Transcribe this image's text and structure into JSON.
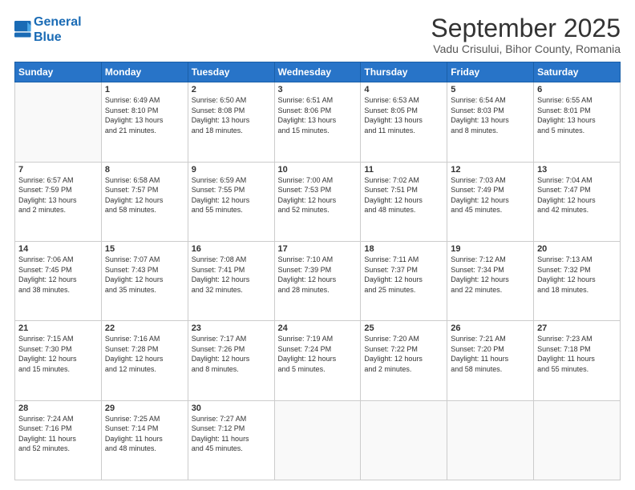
{
  "logo": {
    "line1": "General",
    "line2": "Blue"
  },
  "header": {
    "month": "September 2025",
    "location": "Vadu Crisului, Bihor County, Romania"
  },
  "days_of_week": [
    "Sunday",
    "Monday",
    "Tuesday",
    "Wednesday",
    "Thursday",
    "Friday",
    "Saturday"
  ],
  "weeks": [
    [
      {
        "day": "",
        "detail": ""
      },
      {
        "day": "1",
        "detail": "Sunrise: 6:49 AM\nSunset: 8:10 PM\nDaylight: 13 hours\nand 21 minutes."
      },
      {
        "day": "2",
        "detail": "Sunrise: 6:50 AM\nSunset: 8:08 PM\nDaylight: 13 hours\nand 18 minutes."
      },
      {
        "day": "3",
        "detail": "Sunrise: 6:51 AM\nSunset: 8:06 PM\nDaylight: 13 hours\nand 15 minutes."
      },
      {
        "day": "4",
        "detail": "Sunrise: 6:53 AM\nSunset: 8:05 PM\nDaylight: 13 hours\nand 11 minutes."
      },
      {
        "day": "5",
        "detail": "Sunrise: 6:54 AM\nSunset: 8:03 PM\nDaylight: 13 hours\nand 8 minutes."
      },
      {
        "day": "6",
        "detail": "Sunrise: 6:55 AM\nSunset: 8:01 PM\nDaylight: 13 hours\nand 5 minutes."
      }
    ],
    [
      {
        "day": "7",
        "detail": "Sunrise: 6:57 AM\nSunset: 7:59 PM\nDaylight: 13 hours\nand 2 minutes."
      },
      {
        "day": "8",
        "detail": "Sunrise: 6:58 AM\nSunset: 7:57 PM\nDaylight: 12 hours\nand 58 minutes."
      },
      {
        "day": "9",
        "detail": "Sunrise: 6:59 AM\nSunset: 7:55 PM\nDaylight: 12 hours\nand 55 minutes."
      },
      {
        "day": "10",
        "detail": "Sunrise: 7:00 AM\nSunset: 7:53 PM\nDaylight: 12 hours\nand 52 minutes."
      },
      {
        "day": "11",
        "detail": "Sunrise: 7:02 AM\nSunset: 7:51 PM\nDaylight: 12 hours\nand 48 minutes."
      },
      {
        "day": "12",
        "detail": "Sunrise: 7:03 AM\nSunset: 7:49 PM\nDaylight: 12 hours\nand 45 minutes."
      },
      {
        "day": "13",
        "detail": "Sunrise: 7:04 AM\nSunset: 7:47 PM\nDaylight: 12 hours\nand 42 minutes."
      }
    ],
    [
      {
        "day": "14",
        "detail": "Sunrise: 7:06 AM\nSunset: 7:45 PM\nDaylight: 12 hours\nand 38 minutes."
      },
      {
        "day": "15",
        "detail": "Sunrise: 7:07 AM\nSunset: 7:43 PM\nDaylight: 12 hours\nand 35 minutes."
      },
      {
        "day": "16",
        "detail": "Sunrise: 7:08 AM\nSunset: 7:41 PM\nDaylight: 12 hours\nand 32 minutes."
      },
      {
        "day": "17",
        "detail": "Sunrise: 7:10 AM\nSunset: 7:39 PM\nDaylight: 12 hours\nand 28 minutes."
      },
      {
        "day": "18",
        "detail": "Sunrise: 7:11 AM\nSunset: 7:37 PM\nDaylight: 12 hours\nand 25 minutes."
      },
      {
        "day": "19",
        "detail": "Sunrise: 7:12 AM\nSunset: 7:34 PM\nDaylight: 12 hours\nand 22 minutes."
      },
      {
        "day": "20",
        "detail": "Sunrise: 7:13 AM\nSunset: 7:32 PM\nDaylight: 12 hours\nand 18 minutes."
      }
    ],
    [
      {
        "day": "21",
        "detail": "Sunrise: 7:15 AM\nSunset: 7:30 PM\nDaylight: 12 hours\nand 15 minutes."
      },
      {
        "day": "22",
        "detail": "Sunrise: 7:16 AM\nSunset: 7:28 PM\nDaylight: 12 hours\nand 12 minutes."
      },
      {
        "day": "23",
        "detail": "Sunrise: 7:17 AM\nSunset: 7:26 PM\nDaylight: 12 hours\nand 8 minutes."
      },
      {
        "day": "24",
        "detail": "Sunrise: 7:19 AM\nSunset: 7:24 PM\nDaylight: 12 hours\nand 5 minutes."
      },
      {
        "day": "25",
        "detail": "Sunrise: 7:20 AM\nSunset: 7:22 PM\nDaylight: 12 hours\nand 2 minutes."
      },
      {
        "day": "26",
        "detail": "Sunrise: 7:21 AM\nSunset: 7:20 PM\nDaylight: 11 hours\nand 58 minutes."
      },
      {
        "day": "27",
        "detail": "Sunrise: 7:23 AM\nSunset: 7:18 PM\nDaylight: 11 hours\nand 55 minutes."
      }
    ],
    [
      {
        "day": "28",
        "detail": "Sunrise: 7:24 AM\nSunset: 7:16 PM\nDaylight: 11 hours\nand 52 minutes."
      },
      {
        "day": "29",
        "detail": "Sunrise: 7:25 AM\nSunset: 7:14 PM\nDaylight: 11 hours\nand 48 minutes."
      },
      {
        "day": "30",
        "detail": "Sunrise: 7:27 AM\nSunset: 7:12 PM\nDaylight: 11 hours\nand 45 minutes."
      },
      {
        "day": "",
        "detail": ""
      },
      {
        "day": "",
        "detail": ""
      },
      {
        "day": "",
        "detail": ""
      },
      {
        "day": "",
        "detail": ""
      }
    ]
  ]
}
